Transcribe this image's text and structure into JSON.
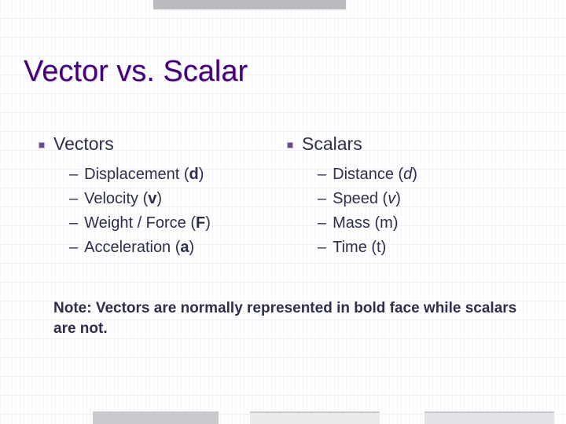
{
  "title": "Vector vs. Scalar",
  "left": {
    "heading": "Vectors",
    "items": [
      {
        "label": "Displacement",
        "symbol": "d",
        "symbol_style": "bold"
      },
      {
        "label": "Velocity",
        "symbol": "v",
        "symbol_style": "bold"
      },
      {
        "label": "Weight / Force",
        "symbol": "F",
        "symbol_style": "bold"
      },
      {
        "label": " Acceleration",
        "symbol": "a",
        "symbol_style": "bold"
      }
    ]
  },
  "right": {
    "heading": "Scalars",
    "items": [
      {
        "label": "Distance",
        "symbol": "d",
        "symbol_style": "italic"
      },
      {
        "label": "Speed",
        "symbol": "v",
        "symbol_style": "italic"
      },
      {
        "label": "Mass",
        "symbol": "m",
        "symbol_style": "plain"
      },
      {
        "label": "Time",
        "symbol": "t",
        "symbol_style": "plain"
      }
    ]
  },
  "note": "Note: Vectors are normally represented in bold face while scalars are not."
}
